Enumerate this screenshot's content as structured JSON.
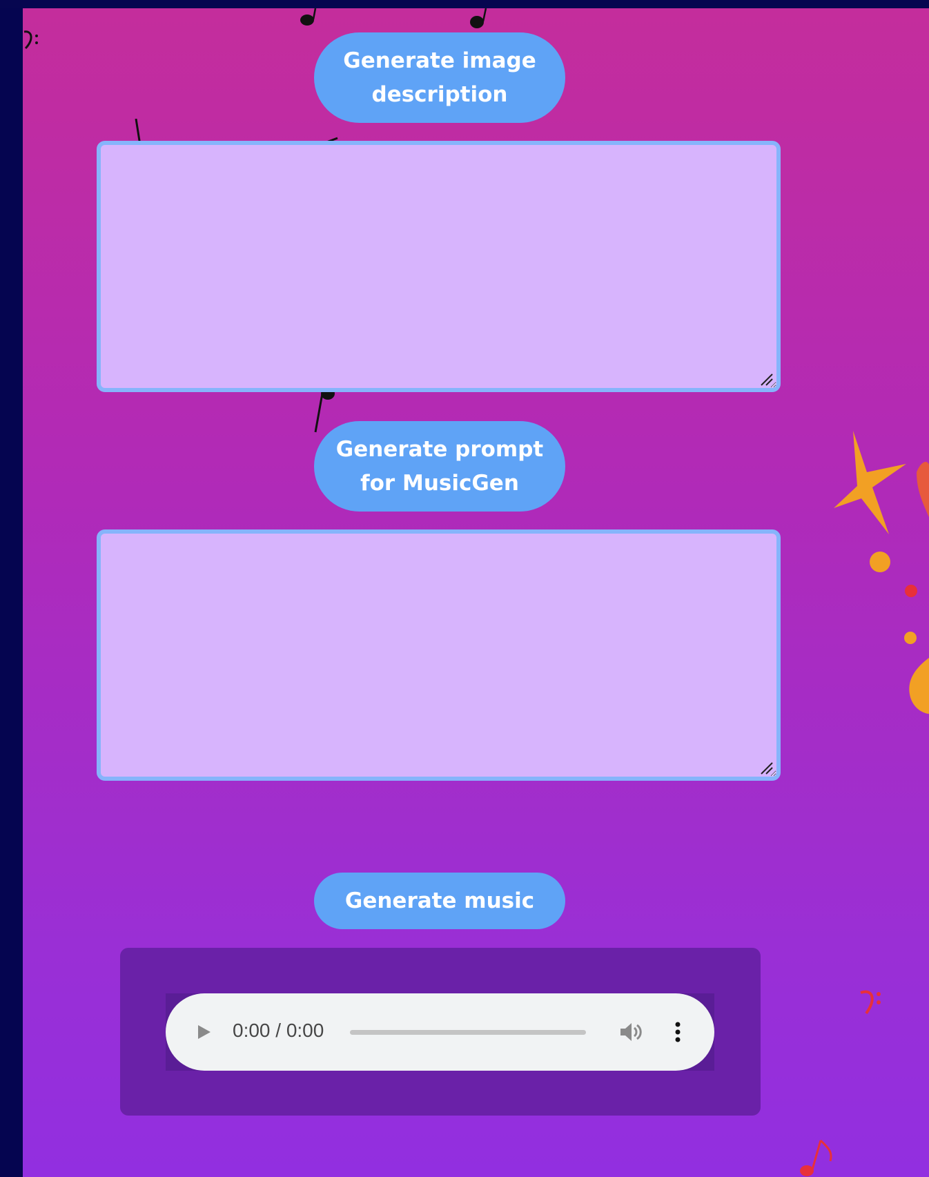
{
  "buttons": {
    "generate_description": "Generate image description",
    "generate_prompt": "Generate prompt for MusicGen",
    "generate_music": "Generate music"
  },
  "fields": {
    "image_description": {
      "value": "",
      "placeholder": ""
    },
    "musicgen_prompt": {
      "value": "",
      "placeholder": ""
    }
  },
  "audio_player": {
    "time_display": "0:00 / 0:00",
    "progress": 0,
    "icons": [
      "play-icon",
      "volume-icon",
      "more-options-icon"
    ]
  },
  "decorations": [
    "music-note-icon",
    "star-burst-icon",
    "bass-clef-icon",
    "dot-icon"
  ],
  "colors": {
    "background_top": "#c42d9c",
    "background_bottom": "#922fe0",
    "button": "#5fa3f6",
    "textbox_fill": "#d7b4fd",
    "textbox_border": "#86b4fb",
    "audio_panel": "#6a21a8",
    "player": "#f1f3f4",
    "outer": "#050550"
  }
}
